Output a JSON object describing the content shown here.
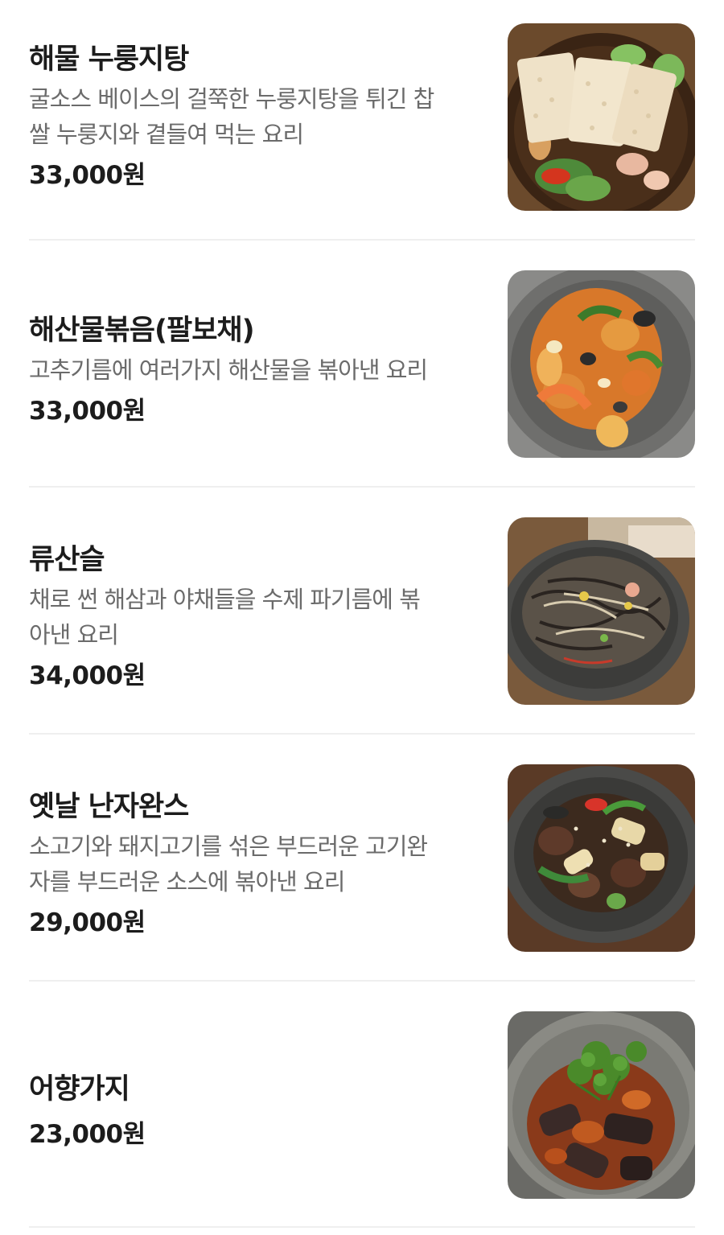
{
  "menu": {
    "items": [
      {
        "name": "해물 누룽지탕",
        "description_lines": [
          "굴소스 베이스의 걸쭉한 누룽지탕을 튀긴 찹",
          "쌀 누룽지와 곁들여 먹는 요리"
        ],
        "price": "33,000원",
        "photo_icon": "seafood-nurungji-soup-photo"
      },
      {
        "name": "해산물볶음(팔보채)",
        "description_lines": [
          "고추기름에 여러가지 해산물을 볶아낸 요리"
        ],
        "price": "33,000원",
        "photo_icon": "palbochae-photo"
      },
      {
        "name": "류산슬",
        "description_lines": [
          "채로 썬 해삼과 야채들을 수제 파기름에 볶",
          "아낸 요리"
        ],
        "price": "34,000원",
        "photo_icon": "ryusanseul-photo"
      },
      {
        "name": "옛날 난자완스",
        "description_lines": [
          "소고기와 돼지고기를 섞은 부드러운 고기완",
          "자를 부드러운 소스에 볶아낸 요리"
        ],
        "price": "29,000원",
        "photo_icon": "nanjawanseu-photo"
      },
      {
        "name": "어향가지",
        "description_lines": [],
        "price": "23,000원",
        "photo_icon": "eohyang-eggplant-photo"
      }
    ]
  }
}
